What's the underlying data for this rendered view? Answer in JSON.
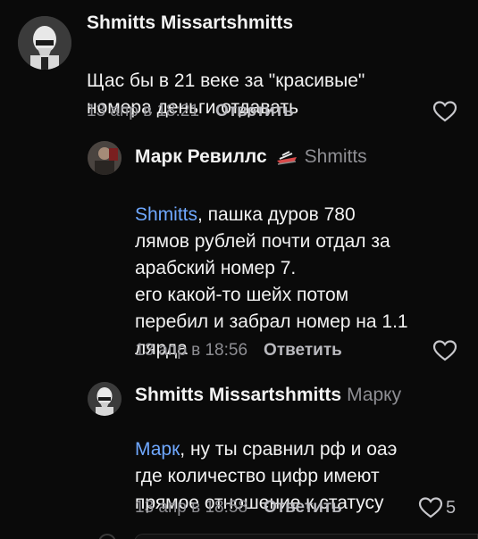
{
  "comments": [
    {
      "author": "Shmitts Missartshmitts",
      "reply_to": "",
      "mention": "",
      "text": "Щас бы в 21 веке за  \"красивые\"\nномера деньги отдавать",
      "time": "13 апр в 18:21",
      "reply_label": "Ответить",
      "likes": "",
      "avatar": "stormtrooper-avatar"
    },
    {
      "author": "Марк Ревиллс",
      "badge_icon": "boat-emoji-icon",
      "reply_to": "Shmitts",
      "mention": "Shmitts",
      "text": ", пашка дуров 780\nлямов рублей почти отдал за\nарабский номер 7.\nего какой-то шейх потом\nперебил и забрал номер на 1.1\nлярда",
      "time": "13 апр в 18:56",
      "reply_label": "Ответить",
      "likes": "",
      "avatar": "user-photo-avatar"
    },
    {
      "author": "Shmitts Missartshmitts",
      "reply_to": "Марку",
      "mention": "Марк",
      "text": ", ну ты сравнил рф и оаэ\nгде количество цифр имеют\nпрямое отношение к статусу",
      "time": "13 апр в 18:58",
      "reply_label": "Ответить",
      "likes": "5",
      "avatar": "stormtrooper-avatar"
    }
  ],
  "colors": {
    "background": "#0a0a0a",
    "mention": "#6fa8ff",
    "muted": "#8e8e93"
  }
}
